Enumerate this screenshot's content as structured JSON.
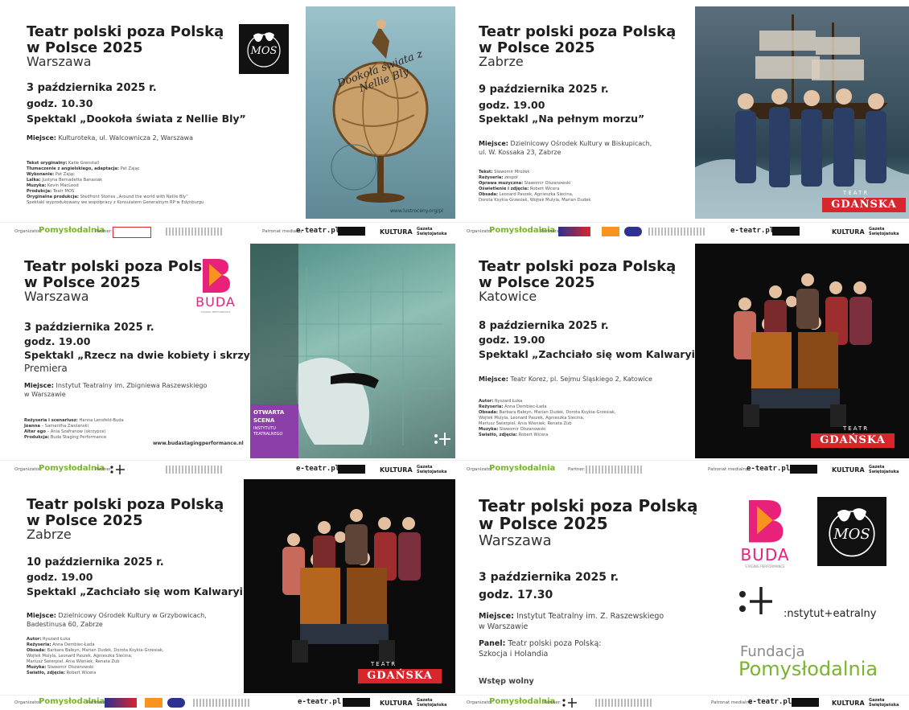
{
  "series_line1": "Teatr polski poza Polską",
  "series_line2": "w Polsce 2025",
  "panels": {
    "p1": {
      "city": "Warszawa",
      "date": "3 października 2025 r.",
      "time": "godz. 10.30",
      "show": "Spektakl „Dookoła świata z Nellie Bly”",
      "venue_label": "Miejsce:",
      "venue": " Kulturoteka, ul. Walcownicza 2, Warszawa",
      "credits": [
        [
          "Tekst oryginalny:",
          " Katie Grenstall"
        ],
        [
          "Tłumaczenie z angielskiego, adaptacja:",
          " Pat Zając"
        ],
        [
          "Wykonanie:",
          " Pat Zając"
        ],
        [
          "Lalka:",
          " Justyna Bernadetta Banasiak"
        ],
        [
          "Muzyka:",
          " Kevin MacLeod"
        ],
        [
          "Produkcja:",
          " Teatr MOS"
        ],
        [
          "Oryginalna produkcja:",
          " Stedfront Stories „Around the world with Nellie Bly”"
        ],
        [
          "",
          "Spektakl wyprodukowany we współpracy z Konsulatem Generalnym RP w Edynburgu"
        ]
      ],
      "poster_title": "Dookoła świata z Nellie Bly",
      "poster_url": "www.lustroceny.org/pl",
      "mos_logo": "MOS"
    },
    "p2": {
      "city": "Zabrze",
      "date": "9 października 2025 r.",
      "time": "godz. 19.00",
      "show": "Spektakl „Na pełnym morzu”",
      "venue_label": "Miejsce:",
      "venue_line1": " Dzielnicowy Ośrodek Kultury w Biskupicach,",
      "venue_line2": "ul. W. Kossaka 23, Zabrze",
      "credits": [
        [
          "Tekst:",
          " Sławomir Mrożek"
        ],
        [
          "Reżyseria:",
          " zespół"
        ],
        [
          "Oprawa muzyczna:",
          " Sławomir Olszanowski"
        ],
        [
          "Oświetlenie i zdjęcia:",
          " Robert Wicera"
        ],
        [
          "Obsada:",
          " Leonard Paszek, Agnieszka Siecina,"
        ],
        [
          "",
          "Dorota Ksykia-Grzesiak, Wojtek Mulyla, Marian Dudek"
        ]
      ],
      "teatr": "TEATR",
      "gdanska": "GDAŃSKA"
    },
    "p3": {
      "city": "Warszawa",
      "date": "3 października 2025 r.",
      "time": "godz. 19.00",
      "show": "Spektakl „Rzecz na dwie kobiety i skrzypce”",
      "premiere": "Premiera",
      "venue_label": "Miejsce:",
      "venue_line1": " Instytut Teatralny im. Zbigniewa Raszewskiego",
      "venue_line2": "w Warszawie",
      "credits": [
        [
          "Reżyseria i scenariusz:",
          " Hanna Lensfeld-Buda"
        ],
        [
          "Joanna",
          " – Samantha Zwolanski"
        ],
        [
          "Alter ego",
          " – Ania Szafranow (skrzypce)"
        ],
        [
          "Produkcja:",
          " Buda Staging Performance"
        ]
      ],
      "url": "www.budastagingperformance.nl",
      "buda": "BUDA",
      "buda_sub": "STAGING PERFORMANCE",
      "otwarta1": "OTWARTA",
      "otwarta2": "SCENA",
      "otwarta3": "INSTYTUTU",
      "otwarta4": "TEATRALNEGO"
    },
    "p4": {
      "city": "Katowice",
      "date": "8 października 2025 r.",
      "time": "godz. 19.00",
      "show": "Spektakl „Zachciało się wom Kalwaryi”",
      "venue_label": "Miejsce:",
      "venue": " Teatr Korez, pl. Sejmu Śląskiego 2, Katowice",
      "credits": [
        [
          "Autor:",
          " Ryszard Łuka"
        ],
        [
          "Reżyseria:",
          " Anna Dembiec-Łada"
        ],
        [
          "Obsada:",
          " Barbara Bałeyn, Marian Dudek, Dorota Ksykia-Grzesiak,"
        ],
        [
          "",
          "Wojtek Mulyla, Leonard Paszek, Agnieszka Siecina,"
        ],
        [
          "",
          "Mariusz Świerpiel, Ania Wieniek, Renata Zub"
        ],
        [
          "Muzyka:",
          " Sławomir Olszanowski"
        ],
        [
          "Światło, zdjęcia:",
          " Robert Wicera"
        ]
      ],
      "teatr": "TEATR",
      "gdanska": "GDAŃSKA"
    },
    "p5": {
      "city": "Zabrze",
      "date": "10 października 2025 r.",
      "time": "godz. 19.00",
      "show": "Spektakl „Zachciało się wom Kalwaryi”",
      "venue_label": "Miejsce:",
      "venue_line1": " Dzielnicowy Ośrodek Kultury w Grzybowicach,",
      "venue_line2": "Badestinusa 60, Zabrze",
      "credits": [
        [
          "Autor:",
          " Ryszard Łuka"
        ],
        [
          "Reżyseria:",
          " Anna Dembiec-Łada"
        ],
        [
          "Obsada:",
          " Barbara Bałeyn, Marian Dudek, Dorota Ksykia-Grzesiak,"
        ],
        [
          "",
          "Wojtek Mulyla, Leonard Paszek, Agnieszka Siecina,"
        ],
        [
          "",
          "Mariusz Świerpiel, Ania Wieniek, Renata Zub"
        ],
        [
          "Muzyka:",
          " Sławomir Olszanowski"
        ],
        [
          "Światło, zdjęcia:",
          " Robert Wicera"
        ]
      ],
      "teatr": "TEATR",
      "gdanska": "GDAŃSKA"
    },
    "p6": {
      "city": "Warszawa",
      "date": "3 października 2025 r.",
      "time": "godz. 17.30",
      "venue_label": "Miejsce:",
      "venue_line1": " Instytut Teatralny im. Z. Raszewskiego",
      "venue_line2": "w Warszawie",
      "panel_label": "Panel:",
      "panel_line1": " Teatr polski poza Polską:",
      "panel_line2": "Szkocja i Holandia",
      "entry": "Wstęp wolny",
      "buda": "BUDA",
      "buda_sub": "STAGING PERFORMANCE",
      "mos_logo": "MOS",
      "instytut": ":nstytut+eatralny",
      "fundacja1": "Fundacja",
      "fundacja2": "Pomysłodalnia"
    }
  },
  "footer": {
    "organizer_label": "Organizator:",
    "organizer": "Pomysłodalnia",
    "fundacja_small": "Fundacja",
    "partner_label": "Partner:",
    "partners_label": "Partnerzy:",
    "media_label": "Patronat medialny:",
    "etea": "e-teatr.pl",
    "kultura": "KULTURA",
    "gazeta": "Gazeta Świętojańska"
  },
  "colors": {
    "buda_pink": "#e8217a",
    "buda_orange": "#f7931e",
    "gdanska_red": "#d7262c",
    "fund_green": "#7ab32e",
    "fund_grey": "#8a8a8a",
    "otwarta_purple": "#8c3fa8"
  }
}
